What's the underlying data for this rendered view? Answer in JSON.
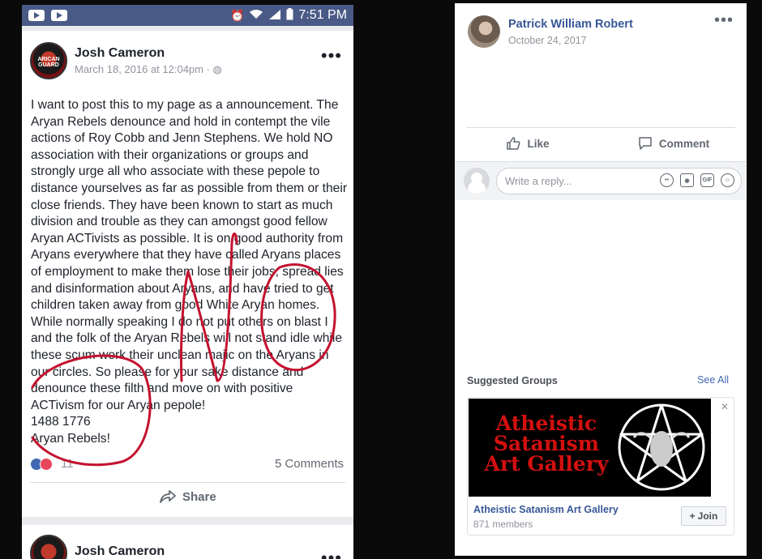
{
  "status_bar": {
    "time": "7:51 PM"
  },
  "post": {
    "author": "Josh Cameron",
    "avatar_caption": "ARICAN GUARD",
    "date": "March 18, 2016 at 12:04pm · ",
    "body": "I want to post this to my page as a announcement. The Aryan Rebels denounce and hold in contempt the vile actions of Roy Cobb and Jenn Stephens. We hold NO association with their organizations or groups and strongly urge all who associate with these pepole to distance yourselves as far as possible from them or their close friends. They have been known to start as much division and trouble as they can amongst good fellow Aryan ACTivists as possible. It is on good authority from Aryans everywhere that they have called Aryans places of employment to make them lose their jobs, spread lies and disinformation about Aryans, and have tried to get children taken away from good White Aryan homes. While normally speaking I do not put others on blast I and the folk of the Aryan Rebels will not stand idle while these scum work their unclean majic on the Aryans in our circles. So please for your sake distance and denounce these filth and move on with positive ACTivism for our Aryan pepole!",
    "signature_line1": "1488 1776",
    "signature_line2": "Aryan Rebels!",
    "reaction_count": "11",
    "comments": "5 Comments",
    "share_label": "Share",
    "annotation": "NO"
  },
  "post2": {
    "author": "Josh Cameron"
  },
  "reply_post": {
    "author": "Patrick William Robert",
    "date": "October 24, 2017",
    "like_label": "Like",
    "comment_label": "Comment",
    "reply_placeholder": "Write a reply..."
  },
  "suggested_groups": {
    "title": "Suggested Groups",
    "see_all": "See All",
    "group": {
      "banner_text": "Atheistic Satanism Art Gallery",
      "name": "Atheistic Satanism Art Gallery",
      "members": "871 members",
      "join_label": "Join"
    }
  },
  "colors": {
    "fb_blue": "#4267b2",
    "link_blue": "#385898",
    "status_bar": "#4a5a86",
    "annotation": "#c4122f",
    "banner_red": "#d31010"
  }
}
